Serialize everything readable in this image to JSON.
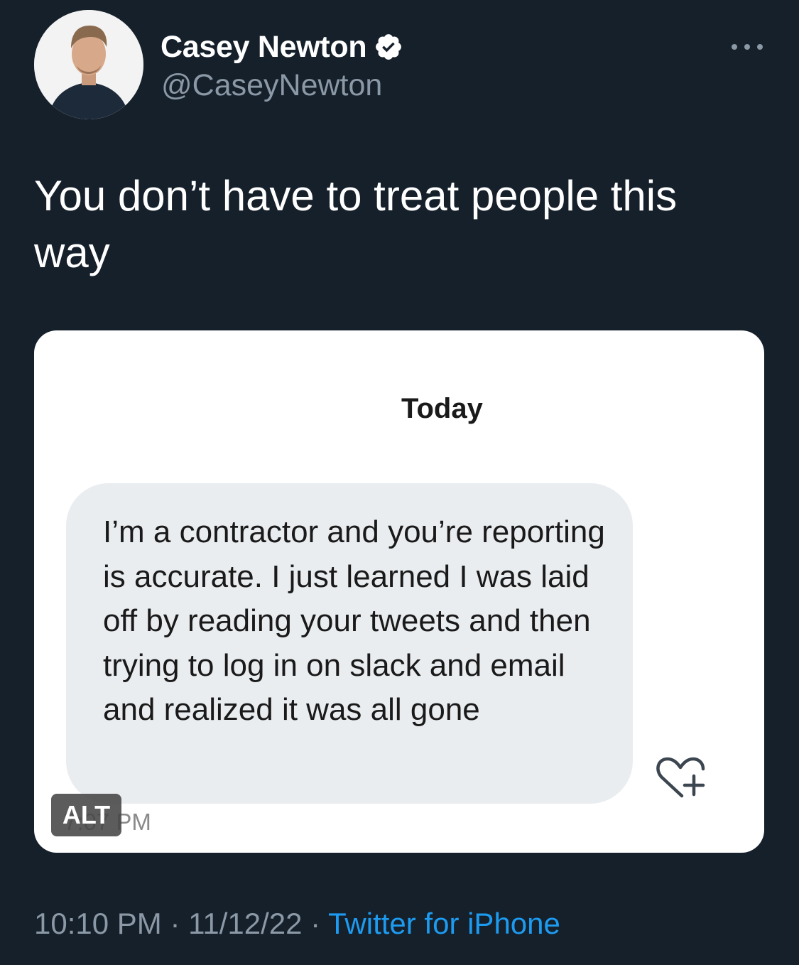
{
  "author": {
    "display_name": "Casey Newton",
    "handle": "@CaseyNewton",
    "verified": true
  },
  "tweet": {
    "text": "You don’t have to treat people this way"
  },
  "media": {
    "date_header": "Today",
    "message": "I’m a contractor and you’re reporting is accurate. I just learned I was laid off by reading your tweets and then trying to log in on slack and email and realized it was all gone",
    "message_time": "7:07 PM",
    "alt_badge": "ALT"
  },
  "footer": {
    "time": "10:10 PM",
    "separator1": " · ",
    "date": "11/12/22",
    "separator2": " · ",
    "source": "Twitter for iPhone"
  },
  "icons": [
    "verified-badge-icon",
    "more-options-icon",
    "heart-plus-icon"
  ],
  "colors": {
    "background": "#15202b",
    "secondary_text": "#8b98a5",
    "link": "#1d9bf0",
    "bubble": "#eaedf0"
  }
}
